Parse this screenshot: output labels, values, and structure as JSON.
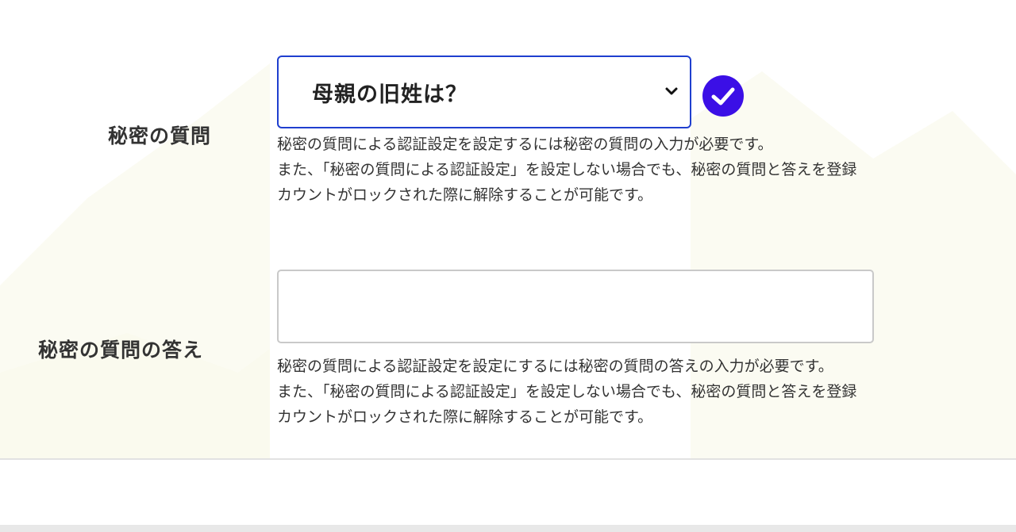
{
  "form": {
    "question": {
      "label": "秘密の質問",
      "selected": "母親の旧姓は？",
      "help": [
        "秘密の質問による認証設定を設定するには秘密の質問の入力が必要です。",
        "また、「秘密の質問による認証設定」を設定しない場合でも、秘密の質問と答えを登録",
        "カウントがロックされた際に解除することが可能です。"
      ]
    },
    "answer": {
      "label": "秘密の質問の答え",
      "value": "",
      "placeholder": "",
      "help": [
        "秘密の質問による認証設定を設定にするには秘密の質問の答えの入力が必要です。",
        "また、「秘密の質問による認証設定」を設定しない場合でも、秘密の質問と答えを登録",
        "カウントがロックされた際に解除することが可能です。"
      ]
    }
  },
  "icons": {
    "dropdown": "chevron-down-icon",
    "valid": "check-circle-icon"
  },
  "colors": {
    "accent": "#1f3fcf",
    "check": "#3b0fe6",
    "background_pattern": "#fbfbf2"
  }
}
